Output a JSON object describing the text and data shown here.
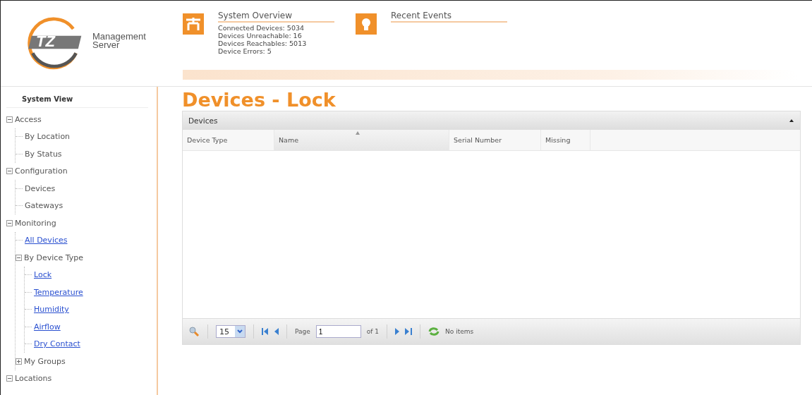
{
  "logo": {
    "mark": "TZ",
    "name_line1": "Management",
    "name_line2": "Server"
  },
  "overview": {
    "title": "System Overview",
    "lines": [
      "Connected Devices: 5034",
      "Devices Unreachable: 16",
      "Devices Reachables: 5013",
      "Device Errors: 5"
    ]
  },
  "recent_events": {
    "title": "Recent Events"
  },
  "sidebar": {
    "title": "System View",
    "tree": [
      {
        "label": "Access",
        "kind": "node",
        "expanded": true,
        "children": [
          {
            "label": "By Location",
            "kind": "node"
          },
          {
            "label": "By Status",
            "kind": "node"
          }
        ]
      },
      {
        "label": "Configuration",
        "kind": "node",
        "expanded": true,
        "children": [
          {
            "label": "Devices",
            "kind": "node"
          },
          {
            "label": "Gateways",
            "kind": "node"
          }
        ]
      },
      {
        "label": "Monitoring",
        "kind": "node",
        "expanded": true,
        "children": [
          {
            "label": "All Devices",
            "kind": "link"
          },
          {
            "label": "By Device Type",
            "kind": "node",
            "expanded": true,
            "children": [
              {
                "label": "Lock",
                "kind": "link"
              },
              {
                "label": "Temperature",
                "kind": "link"
              },
              {
                "label": "Humidity",
                "kind": "link"
              },
              {
                "label": "Airflow",
                "kind": "link"
              },
              {
                "label": "Dry Contact",
                "kind": "link"
              }
            ]
          },
          {
            "label": "My Groups",
            "kind": "node",
            "expanded": false
          }
        ]
      },
      {
        "label": "Locations",
        "kind": "node",
        "expanded": true
      }
    ]
  },
  "page_title": "Devices - Lock",
  "grid": {
    "title": "Devices",
    "columns": [
      {
        "label": "Device Type",
        "sorted": false
      },
      {
        "label": "Name",
        "sorted": true
      },
      {
        "label": "Serial Number",
        "sorted": false
      },
      {
        "label": "Missing",
        "sorted": false
      }
    ],
    "pager": {
      "page_size": "15",
      "page_label": "Page",
      "page": "1",
      "of": "of 1",
      "status": "No items"
    }
  }
}
